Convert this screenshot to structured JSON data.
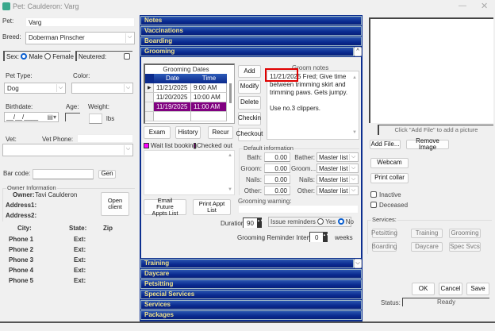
{
  "window": {
    "title": "Pet: Caulderon: Varg",
    "minimize_icon": "minimize-icon",
    "close_icon": "close-icon"
  },
  "pet": {
    "pet_label": "Pet:",
    "pet_value": "Varg",
    "breed_label": "Breed:",
    "breed_value": "Doberman Pinscher",
    "sex_label": "Sex:",
    "male_label": "Male",
    "female_label": "Female",
    "sex_selected": "Male",
    "neutered_label": "Neutered:",
    "neutered_checked": false,
    "pet_type_label": "Pet Type:",
    "pet_type_value": "Dog",
    "color_label": "Color:",
    "color_value": "",
    "birthdate_label": "Birthdate:",
    "birthdate_value": "__/__/____",
    "age_label": "Age:",
    "weight_label": "Weight:",
    "weight_unit": "lbs",
    "vet_label": "Vet:",
    "vet_phone_label": "Vet Phone:",
    "barcode_label": "Bar code:",
    "gen_button": "Gen"
  },
  "owner": {
    "group_label": "Owner Information",
    "owner_label": "Owner:",
    "owner_value": "Tavi Caulderon",
    "address1_label": "Address1:",
    "address2_label": "Address2:",
    "open_client_button": "Open client",
    "city_label": "City:",
    "state_label": "State:",
    "zip_label": "Zip",
    "phones": [
      {
        "label": "Phone 1",
        "ext": "Ext:"
      },
      {
        "label": "Phone 2",
        "ext": "Ext:"
      },
      {
        "label": "Phone 3",
        "ext": "Ext:"
      },
      {
        "label": "Phone 4",
        "ext": "Ext:"
      },
      {
        "label": "Phone 5",
        "ext": "Ext:"
      }
    ]
  },
  "sections_top": [
    "Notes",
    "Vaccinations",
    "Boarding",
    "Grooming"
  ],
  "sections_bottom": [
    "Training",
    "Daycare",
    "Petsitting",
    "Special Services",
    "Services",
    "Packages"
  ],
  "grooming": {
    "grid_title": "Grooming Dates",
    "columns": [
      "Date",
      "Time"
    ],
    "rows": [
      {
        "date": "11/21/2025",
        "time": "9:00 AM",
        "current": true
      },
      {
        "date": "11/20/2025",
        "time": "10:00 AM"
      },
      {
        "date": "11/19/2025",
        "time": "11:00 AM",
        "checked_out": true
      }
    ],
    "buttons": [
      "Add",
      "Modify",
      "Delete",
      "Checkin",
      "Checkout"
    ],
    "exam_button": "Exam",
    "history_button": "History",
    "recur_button": "Recur",
    "legend_wait": "Wait list booking",
    "legend_checked": "Checked out",
    "notes_label": "Groom notes",
    "notes_date": "11/21/2025",
    "notes_line1": " Fred; Give time between trimming skirt and trimming paws. Gets jumpy.",
    "notes_line2": "Use no.3 clippers.",
    "email_button": "Email Future Appts List",
    "print_button": "Print Appt List",
    "default_info_label": "Default information",
    "prices": [
      {
        "label": "Bath:",
        "value": "0.00",
        "staff_label": "Bather:",
        "staff_value": "Master list"
      },
      {
        "label": "Groom:",
        "value": "0.00",
        "staff_label": "Groom...",
        "staff_value": "Master list"
      },
      {
        "label": "Nails:",
        "value": "0.00",
        "staff_label": "Nails:",
        "staff_value": "Master list"
      },
      {
        "label": "Other:",
        "value": "0.00",
        "staff_label": "Other:",
        "staff_value": "Master list"
      }
    ],
    "warning_label": "Grooming warning:",
    "duration_label": "Duration:",
    "duration_value": "90",
    "issue_reminders_label": "Issue reminders",
    "yes_label": "Yes",
    "no_label": "No",
    "reminders_selected": "No",
    "interval_label": "Grooming Reminder Interval:",
    "interval_value": "0",
    "interval_unit": "weeks",
    "colors": {
      "wait": "#ff00ff",
      "checked": "#800080",
      "highlight": "#e00000"
    }
  },
  "right": {
    "picture_caption": "Click \"Add File\" to add a picture",
    "add_file_button": "Add File...",
    "remove_image_button": "Remove Image",
    "webcam_button": "Webcam",
    "print_collar_button": "Print collar",
    "inactive_label": "Inactive",
    "deceased_label": "Deceased",
    "services_label": "Services:",
    "services": [
      "Petsitting",
      "Training",
      "Grooming",
      "Boarding",
      "Daycare",
      "Spec Svcs"
    ],
    "ok_button": "OK",
    "cancel_button": "Cancel",
    "save_button": "Save",
    "status_label": "Status:",
    "status_value": "Ready"
  }
}
